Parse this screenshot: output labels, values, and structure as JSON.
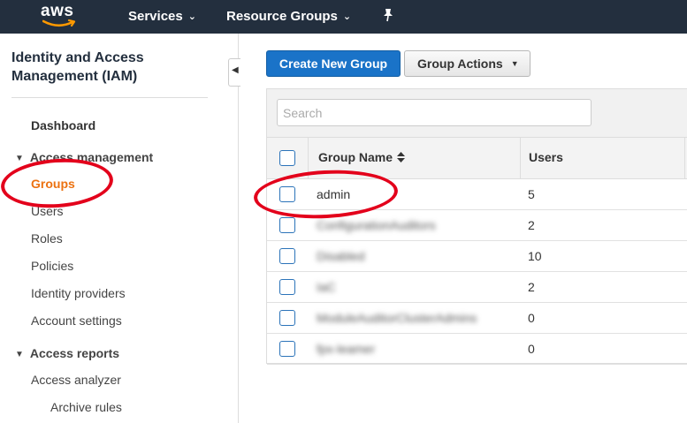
{
  "topnav": {
    "logo_text": "aws",
    "services_label": "Services",
    "resource_groups_label": "Resource Groups"
  },
  "sidebar": {
    "title": "Identity and Access Management (IAM)",
    "dashboard": "Dashboard",
    "access_management": {
      "label": "Access management",
      "items": [
        "Groups",
        "Users",
        "Roles",
        "Policies",
        "Identity providers",
        "Account settings"
      ]
    },
    "access_reports": {
      "label": "Access reports",
      "items": [
        "Access analyzer"
      ],
      "subitems": [
        "Archive rules"
      ]
    }
  },
  "toolbar": {
    "create_label": "Create New Group",
    "actions_label": "Group Actions"
  },
  "search": {
    "placeholder": "Search"
  },
  "table": {
    "columns": [
      "Group Name",
      "Users"
    ],
    "rows": [
      {
        "name": "admin",
        "users": "5"
      },
      {
        "name": "ConfigurationAuditors",
        "users": "2"
      },
      {
        "name": "Disabled",
        "users": "10"
      },
      {
        "name": "IaC",
        "users": "2"
      },
      {
        "name": "ModuleAuditorClusterAdmins",
        "users": "0"
      },
      {
        "name": "fpx-leamer",
        "users": "0"
      }
    ]
  },
  "colors": {
    "nav_bg": "#232f3e",
    "primary_button": "#1a73c8",
    "active_link": "#ec7211",
    "annotation": "#e3001b",
    "checkbox_border": "#2b73b9"
  },
  "icons": [
    "aws-logo",
    "chevron-down-icon",
    "pin-icon",
    "collapse-arrow-icon",
    "triangle-down-icon",
    "sort-icon",
    "checkbox"
  ]
}
